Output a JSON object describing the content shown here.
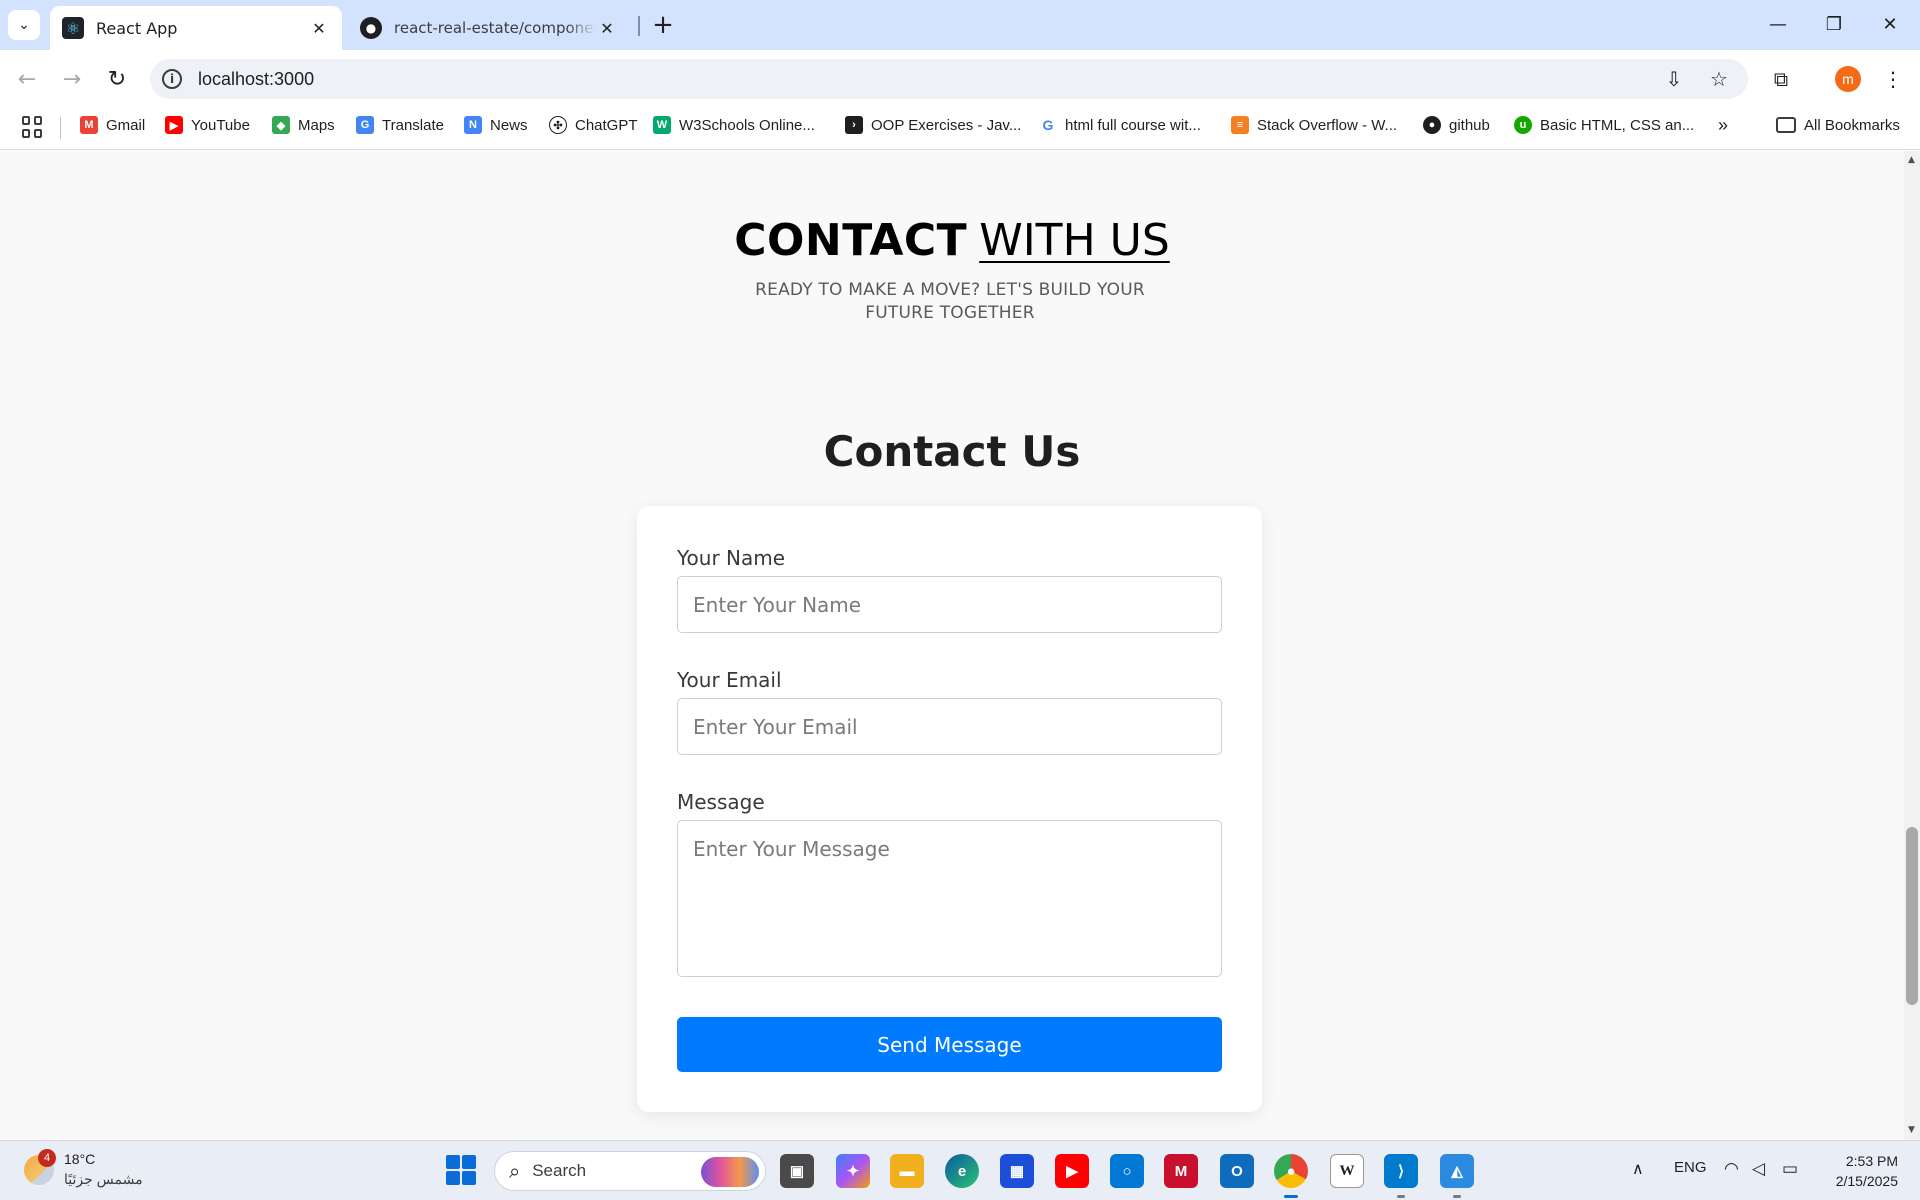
{
  "browser": {
    "tabs": [
      {
        "title": "React App",
        "icon": "react-icon",
        "active": true
      },
      {
        "title": "react-real-estate/components at main",
        "icon": "github-icon",
        "active": false
      }
    ],
    "url": "localhost:3000",
    "profile_initial": "m"
  },
  "bookmarks": [
    {
      "label": "Gmail",
      "icon": "gmail-icon",
      "color": "#ea4335"
    },
    {
      "label": "YouTube",
      "icon": "youtube-icon",
      "color": "#ff0000"
    },
    {
      "label": "Maps",
      "icon": "maps-icon",
      "color": "#34a853"
    },
    {
      "label": "Translate",
      "icon": "translate-icon",
      "color": "#4285f4"
    },
    {
      "label": "News",
      "icon": "news-icon",
      "color": "#4285f4"
    },
    {
      "label": "ChatGPT",
      "icon": "chatgpt-icon",
      "color": "#1f1f1f"
    },
    {
      "label": "W3Schools Online...",
      "icon": "w3schools-icon",
      "color": "#04aa6d"
    },
    {
      "label": "OOP Exercises - Jav...",
      "icon": "terminal-icon",
      "color": "#1f1f1f"
    },
    {
      "label": "html full course wit...",
      "icon": "google-icon",
      "color": "#4285f4"
    },
    {
      "label": "Stack Overflow - W...",
      "icon": "stackoverflow-icon",
      "color": "#f48024"
    },
    {
      "label": "github",
      "icon": "github-icon",
      "color": "#1f1f1f"
    },
    {
      "label": "Basic HTML, CSS an...",
      "icon": "upwork-icon",
      "color": "#14a800"
    }
  ],
  "all_bookmarks_label": "All Bookmarks",
  "page": {
    "heading_strong": "CONTACT",
    "heading_light": "WITH US",
    "subheading": "READY TO MAKE A MOVE? LET'S BUILD YOUR FUTURE TOGETHER",
    "form_title": "Contact Us",
    "form": {
      "name_label": "Your Name",
      "name_placeholder": "Enter Your Name",
      "email_label": "Your Email",
      "email_placeholder": "Enter Your Email",
      "message_label": "Message",
      "message_placeholder": "Enter Your Message",
      "submit_label": "Send Message"
    },
    "accent_color": "#007bff"
  },
  "taskbar": {
    "weather_temp": "18°C",
    "weather_desc": "مشمس جزئيًا",
    "weather_badge": "4",
    "search_placeholder": "Search",
    "language": "ENG",
    "time": "2:53 PM",
    "date": "2/15/2025"
  }
}
